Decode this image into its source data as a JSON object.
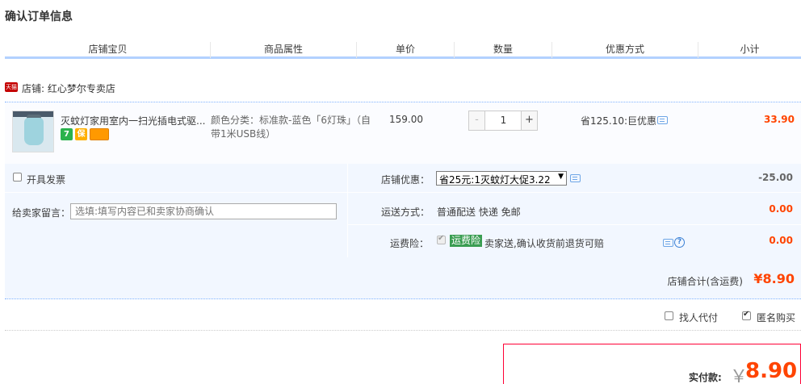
{
  "page": {
    "title": "确认订单信息"
  },
  "table_header": {
    "columns": [
      "店铺宝贝",
      "商品属性",
      "单价",
      "数量",
      "优惠方式",
      "小计"
    ]
  },
  "shop": {
    "badge": "天猫",
    "label": "店铺: 红心梦尔专卖店"
  },
  "item": {
    "title": "灭蚊灯家用室内一扫光插电式驱...",
    "icons": [
      "7",
      "保",
      "card"
    ],
    "attribute": "颜色分类：标准款-蓝色「6灯珠」（自带1米USB线）",
    "price": "159.00",
    "quantity": "1",
    "minus": "-",
    "plus": "+",
    "promo": "省125.10:巨优惠",
    "subtotal": "33.90"
  },
  "options": {
    "invoice_label": "开具发票",
    "message_label": "给卖家留言：",
    "message_placeholder": "选填:填写内容已和卖家协商确认",
    "shop_discount_label": "店铺优惠：",
    "shop_discount_selected": "省25元:1灭蚊灯大促3.22",
    "shop_discount_value": "-25.00",
    "shipping_label": "运送方式：",
    "shipping_value": "普通配送 快递 免邮",
    "shipping_price": "0.00",
    "insurance_label": "运费险：",
    "insurance_badge": "运费险",
    "insurance_text": "卖家送,确认收货前退货可赔",
    "insurance_price": "0.00"
  },
  "total": {
    "label": "店铺合计(含运费)",
    "value": "¥8.90"
  },
  "extras": {
    "proxy_label": "找人代付",
    "anonymous_label": "匿名购买"
  },
  "payment": {
    "label": "实付款:",
    "currency": "￥",
    "value": "8.90"
  },
  "colors": {
    "price_red": "#ff4400",
    "header_border": "#b2d1ff",
    "row_bg": "#f2f7ff",
    "pay_border": "#ff0036"
  }
}
